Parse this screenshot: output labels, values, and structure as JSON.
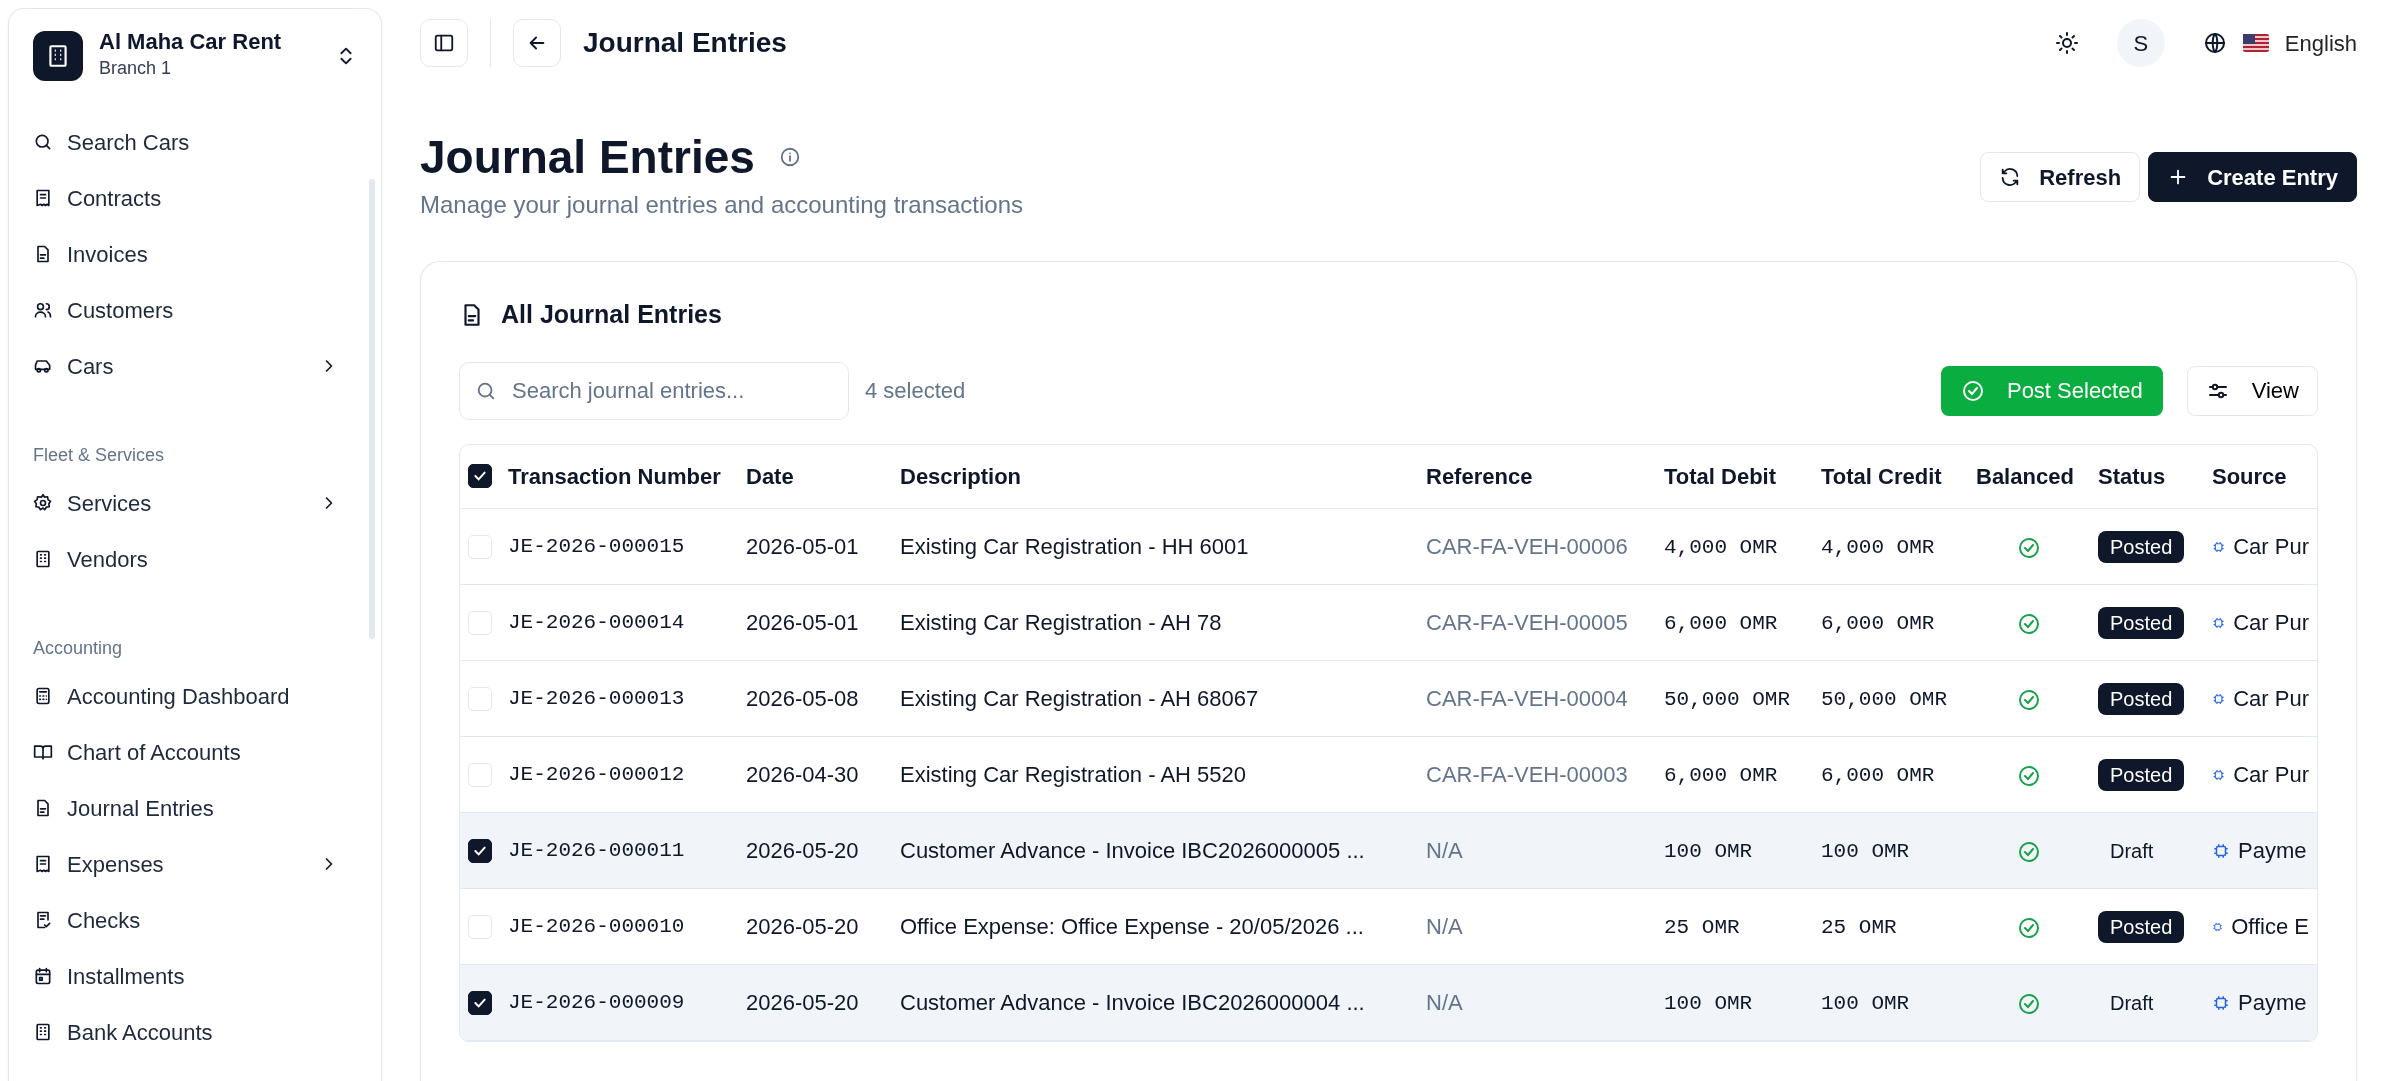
{
  "sidebar": {
    "brand": {
      "name": "Al Maha Car Rent",
      "branch": "Branch 1"
    },
    "sections": [
      {
        "items": [
          {
            "label": "Search Cars",
            "expandable": false
          },
          {
            "label": "Contracts",
            "expandable": false
          },
          {
            "label": "Invoices",
            "expandable": false
          },
          {
            "label": "Customers",
            "expandable": false
          },
          {
            "label": "Cars",
            "expandable": true
          }
        ]
      },
      {
        "title": "Fleet & Services",
        "items": [
          {
            "label": "Services",
            "expandable": true
          },
          {
            "label": "Vendors",
            "expandable": false
          }
        ]
      },
      {
        "title": "Accounting",
        "items": [
          {
            "label": "Accounting Dashboard",
            "expandable": false
          },
          {
            "label": "Chart of Accounts",
            "expandable": false
          },
          {
            "label": "Journal Entries",
            "expandable": false
          },
          {
            "label": "Expenses",
            "expandable": true
          },
          {
            "label": "Checks",
            "expandable": false
          },
          {
            "label": "Installments",
            "expandable": false
          },
          {
            "label": "Bank Accounts",
            "expandable": false
          }
        ]
      }
    ]
  },
  "topbar": {
    "title": "Journal Entries",
    "user_initial": "S",
    "language": "English"
  },
  "page": {
    "title": "Journal Entries",
    "subtitle": "Manage your journal entries and accounting transactions",
    "buttons": [
      {
        "label": "Refresh",
        "kind": "outline"
      },
      {
        "label": "Create Entry",
        "kind": "primary"
      }
    ]
  },
  "card": {
    "title": "All Journal Entries",
    "search": {
      "placeholder": "Search journal entries..."
    },
    "selection_count": "4 selected",
    "post_button": "Post Selected",
    "view_button": "View",
    "table": {
      "select_all_checked": true,
      "columns": [
        "Transaction Number",
        "Date",
        "Description",
        "Reference",
        "Total Debit",
        "Total Credit",
        "Balanced",
        "Status",
        "Source"
      ],
      "rows": [
        {
          "selected": false,
          "number": "JE-2026-000015",
          "date": "2026-05-01",
          "description": "Existing Car Registration - HH 6001",
          "reference": "CAR-FA-VEH-00006",
          "debit": "4,000 OMR",
          "credit": "4,000 OMR",
          "balanced": true,
          "status": {
            "label": "Posted",
            "kind": "posted"
          },
          "source": "Car Pur"
        },
        {
          "selected": false,
          "number": "JE-2026-000014",
          "date": "2026-05-01",
          "description": "Existing Car Registration - AH 78",
          "reference": "CAR-FA-VEH-00005",
          "debit": "6,000 OMR",
          "credit": "6,000 OMR",
          "balanced": true,
          "status": {
            "label": "Posted",
            "kind": "posted"
          },
          "source": "Car Pur"
        },
        {
          "selected": false,
          "number": "JE-2026-000013",
          "date": "2026-05-08",
          "description": "Existing Car Registration - AH 68067",
          "reference": "CAR-FA-VEH-00004",
          "debit": "50,000 OMR",
          "credit": "50,000 OMR",
          "balanced": true,
          "status": {
            "label": "Posted",
            "kind": "posted"
          },
          "source": "Car Pur"
        },
        {
          "selected": false,
          "number": "JE-2026-000012",
          "date": "2026-04-30",
          "description": "Existing Car Registration - AH 5520",
          "reference": "CAR-FA-VEH-00003",
          "debit": "6,000 OMR",
          "credit": "6,000 OMR",
          "balanced": true,
          "status": {
            "label": "Posted",
            "kind": "posted"
          },
          "source": "Car Pur"
        },
        {
          "selected": true,
          "number": "JE-2026-000011",
          "date": "2026-05-20",
          "description": "Customer Advance - Invoice IBC2026000005 ...",
          "reference": "N/A",
          "debit": "100 OMR",
          "credit": "100 OMR",
          "balanced": true,
          "status": {
            "label": "Draft",
            "kind": "draft"
          },
          "source": "Payme"
        },
        {
          "selected": false,
          "number": "JE-2026-000010",
          "date": "2026-05-20",
          "description": "Office Expense: Office Expense - 20/05/2026 ...",
          "reference": "N/A",
          "debit": "25 OMR",
          "credit": "25 OMR",
          "balanced": true,
          "status": {
            "label": "Posted",
            "kind": "posted"
          },
          "source": "Office E"
        },
        {
          "selected": true,
          "number": "JE-2026-000009",
          "date": "2026-05-20",
          "description": "Customer Advance - Invoice IBC2026000004 ...",
          "reference": "N/A",
          "debit": "100 OMR",
          "credit": "100 OMR",
          "balanced": true,
          "status": {
            "label": "Draft",
            "kind": "draft"
          },
          "source": "Payme"
        }
      ]
    }
  }
}
